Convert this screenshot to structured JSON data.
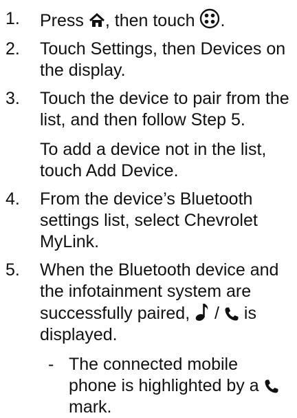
{
  "steps": [
    {
      "number": "1.",
      "text_before_home": "Press ",
      "home_icon": "home-icon",
      "text_between": ", then touch ",
      "apps_icon": "apps-menu-icon",
      "text_after": "."
    },
    {
      "number": "2.",
      "text": "Touch Settings, then Devices on the display."
    },
    {
      "number": "3.",
      "text": "Touch the device to pair from the list, and then follow Step 5.",
      "note": "To add a device not in the list, touch Add Device."
    },
    {
      "number": "4.",
      "text": "From the device’s Bluetooth settings list, select Chevrolet MyLink."
    },
    {
      "number": "5.",
      "text_before": "When the Bluetooth device and the infotainment system are successfully paired, ",
      "music_icon": "music-note-icon",
      "separator": " / ",
      "phone_icon": "phone-icon",
      "text_after": " is displayed.",
      "bullet": {
        "dash": "-",
        "text_before": "The connected mobile phone is highlighted by a ",
        "phone_icon": "phone-icon",
        "text_after": " mark."
      }
    }
  ]
}
